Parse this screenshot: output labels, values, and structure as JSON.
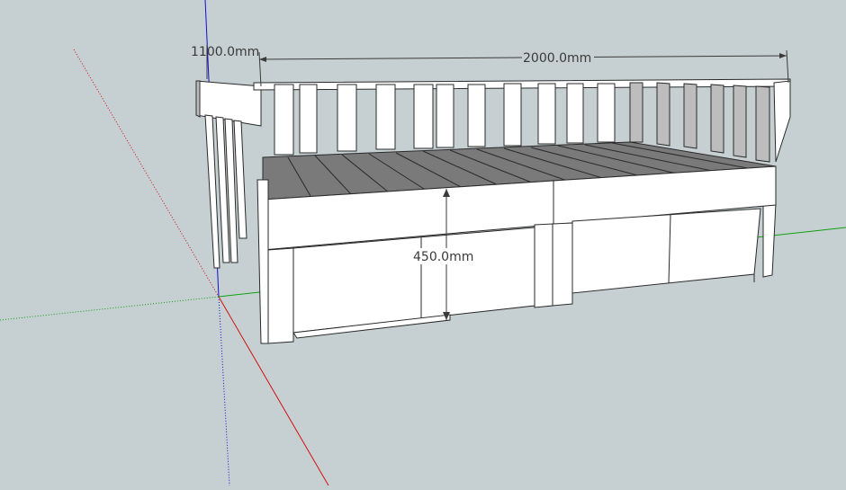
{
  "viewport": {
    "background": "#c6d0d2",
    "axes": {
      "red_axis_color": "#d01010",
      "green_axis_color": "#10a010",
      "blue_axis_color": "#1010d0"
    }
  },
  "model": {
    "name_icon": "daybed-with-drawers-3d-model",
    "colors": {
      "face": "#ffffff",
      "shade": "#bdbdbd",
      "deck": "#7a7a7a",
      "edge": "#2a2a2a"
    }
  },
  "dimensions": {
    "depth_label": "1100.0mm",
    "width_label": "2000.0mm",
    "height_label": "450.0mm"
  }
}
